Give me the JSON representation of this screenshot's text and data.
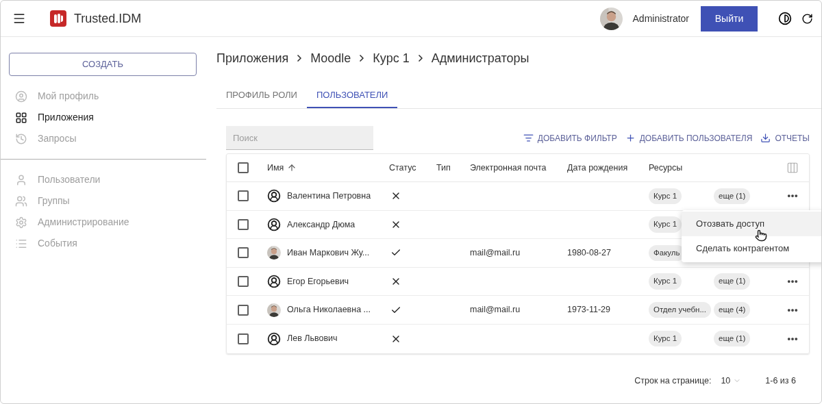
{
  "header": {
    "title": "Trusted.IDM",
    "user_name": "Administrator",
    "logout_button": "Выйти"
  },
  "sidebar": {
    "create_button": "СОЗДАТЬ",
    "groups": [
      [
        {
          "label": "Мой профиль",
          "kind": "profile",
          "selected": false
        },
        {
          "label": "Приложения",
          "kind": "apps",
          "selected": true
        },
        {
          "label": "Запросы",
          "kind": "history",
          "selected": false
        }
      ],
      [
        {
          "label": "Пользователи",
          "kind": "user",
          "selected": false
        },
        {
          "label": "Группы",
          "kind": "group",
          "selected": false
        },
        {
          "label": "Администрирование",
          "kind": "settings",
          "selected": false
        },
        {
          "label": "События",
          "kind": "events",
          "selected": false
        }
      ]
    ]
  },
  "breadcrumb": [
    "Приложения",
    "Moodle",
    "Курс 1",
    "Администраторы"
  ],
  "tabs": [
    {
      "label": "ПРОФИЛЬ РОЛИ",
      "selected": false
    },
    {
      "label": "ПОЛЬЗОВАТЕЛИ",
      "selected": true
    }
  ],
  "toolbar": {
    "search": {
      "placeholder": "Поиск"
    },
    "actions": [
      {
        "label": "ДОБАВИТЬ ФИЛЬТР",
        "kind": "filter"
      },
      {
        "label": "ДОБАВИТЬ ПОЛЬЗОВАТЕЛЯ",
        "kind": "add"
      },
      {
        "label": "ОТЧЕТЫ",
        "kind": "download"
      }
    ]
  },
  "table": {
    "select_all_checked": false,
    "columns": [
      {
        "label": "Имя",
        "sorted": true
      },
      {
        "label": "Статус",
        "sorted": false
      },
      {
        "label": "Тип",
        "sorted": false
      },
      {
        "label": "Электронная почта",
        "sorted": false
      },
      {
        "label": "Дата рождения",
        "sorted": false
      },
      {
        "label": "Ресурсы",
        "sorted": false
      }
    ],
    "rows": [
      {
        "checked": false,
        "has_photo": false,
        "name": "Валентина Петровна",
        "active": false,
        "resource": "Курс 1",
        "more": "еще (1)"
      },
      {
        "checked": false,
        "has_photo": false,
        "name": "Александр Дюма",
        "active": false,
        "resource": "Курс 1"
      },
      {
        "checked": false,
        "has_photo": true,
        "name": "Иван Маркович Жу...",
        "active": true,
        "email": "mail@mail.ru",
        "birth_date": "1980-08-27",
        "resource": "Факуль"
      },
      {
        "checked": false,
        "has_photo": false,
        "name": "Егор Егорьевич",
        "active": false,
        "resource": "Курс 1",
        "more": "еще (1)"
      },
      {
        "checked": false,
        "has_photo": true,
        "name": "Ольга Николаевна ...",
        "active": true,
        "email": "mail@mail.ru",
        "birth_date": "1973-11-29",
        "resource": "Отдел учебн...",
        "more": "еще (4)"
      },
      {
        "checked": false,
        "has_photo": false,
        "name": "Лев Львович",
        "active": false,
        "resource": "Курс 1",
        "more": "еще (1)"
      }
    ]
  },
  "context_menu": {
    "items": [
      {
        "label": "Отозвать доступ",
        "selected": true
      },
      {
        "label": "Сделать контрагентом",
        "selected": false
      }
    ]
  },
  "pagination": {
    "rows_label": "Строк на странице:",
    "rows_value": "10",
    "range": "1-6 из 6"
  }
}
